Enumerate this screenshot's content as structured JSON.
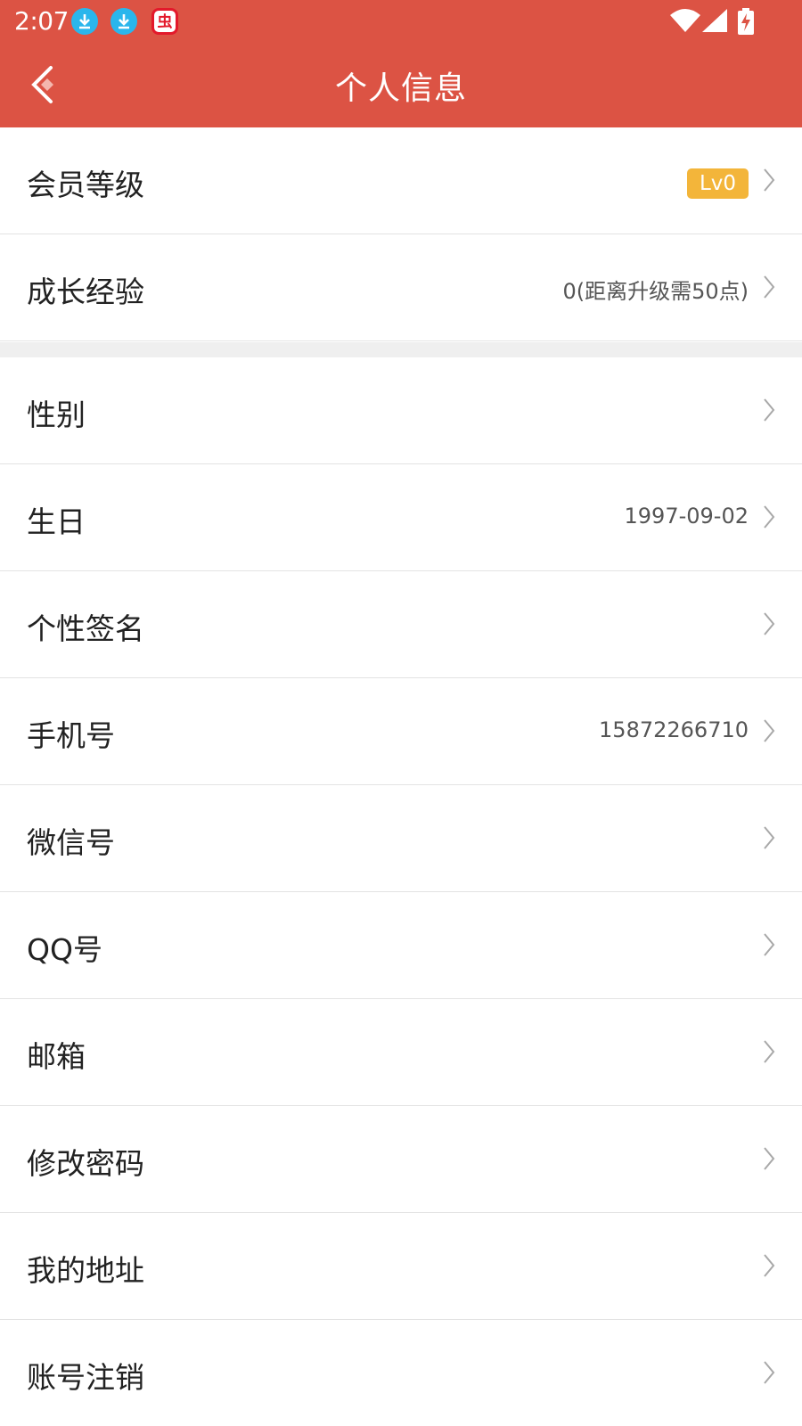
{
  "status_bar": {
    "time": "2:07",
    "icons": [
      "download-icon",
      "download-icon",
      "app-icon",
      "wifi-icon",
      "signal-icon",
      "battery-charging-icon"
    ],
    "app_badge_glyph": "虫"
  },
  "header": {
    "title": "个人信息",
    "back_icon": "back-arrow-icon",
    "background_color": "#dc5344"
  },
  "section_1": {
    "rows": [
      {
        "label": "会员等级",
        "badge": "Lv0"
      },
      {
        "label": "成长经验",
        "value": "0(距离升级需50点)"
      }
    ]
  },
  "section_2": {
    "rows": [
      {
        "label": "性别"
      },
      {
        "label": "生日",
        "value": "1997-09-02"
      },
      {
        "label": "个性签名"
      },
      {
        "label": "手机号",
        "value": "15872266710"
      },
      {
        "label": "微信号"
      },
      {
        "label": "QQ号"
      },
      {
        "label": "邮箱"
      },
      {
        "label": "修改密码"
      },
      {
        "label": "我的地址"
      },
      {
        "label": "账号注销"
      }
    ]
  },
  "colors": {
    "badge": "#f3b53a",
    "download_icon": "#2ab6ec",
    "app_icon": "#e3192b"
  }
}
